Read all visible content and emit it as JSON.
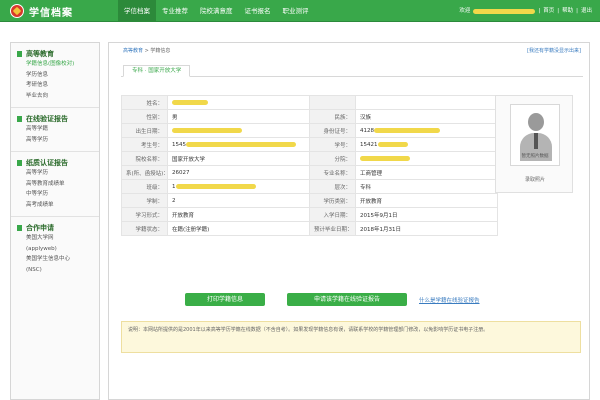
{
  "brand": {
    "title": "学信档案"
  },
  "nav": {
    "items": [
      {
        "label": "学信档案",
        "active": true
      },
      {
        "label": "专业推荐",
        "active": false
      },
      {
        "label": "院校满意度",
        "active": false
      },
      {
        "label": "证书报名",
        "active": false
      },
      {
        "label": "职业测评",
        "active": false
      }
    ]
  },
  "user": {
    "greeting": "欢迎",
    "home": "首页",
    "help": "帮助",
    "logout": "退出",
    "sep": "|"
  },
  "sidebar": {
    "groups": [
      {
        "title": "高等教育",
        "items": [
          {
            "label": "学籍信息(图像校对)",
            "active": true
          },
          {
            "label": "学历信息",
            "active": false
          },
          {
            "label": "考研信息",
            "active": false
          },
          {
            "label": "毕业去向",
            "active": false
          }
        ]
      },
      {
        "title": "在线验证报告",
        "items": [
          {
            "label": "高等学籍",
            "active": false
          },
          {
            "label": "高等学历",
            "active": false
          }
        ]
      },
      {
        "title": "纸质认证报告",
        "items": [
          {
            "label": "高等学历",
            "active": false
          },
          {
            "label": "高等教育成绩单",
            "active": false
          },
          {
            "label": "中等学历",
            "active": false
          },
          {
            "label": "高考成绩单",
            "active": false
          }
        ]
      },
      {
        "title": "合作申请",
        "items": [
          {
            "label": "美国大学网",
            "active": false
          },
          {
            "label": "(applyweb)",
            "active": false
          },
          {
            "label": "美国学生信息中心",
            "active": false
          },
          {
            "label": "(NSC)",
            "active": false
          }
        ]
      }
    ]
  },
  "breadcrumb": {
    "root": "高等教育",
    "sep": ">",
    "current": "学籍信息"
  },
  "help_link": "[我还有学籍没显示出来]",
  "tab": {
    "label": "专科 · 国家开放大学"
  },
  "record": {
    "rows": [
      [
        {
          "label": "姓名：",
          "value": "",
          "redacted": true,
          "width": 36
        },
        {
          "label": "",
          "value": ""
        }
      ],
      [
        {
          "label": "性别：",
          "value": "男"
        },
        {
          "label": "民族：",
          "value": "汉族"
        }
      ],
      [
        {
          "label": "出生日期：",
          "value": "",
          "redacted": true,
          "width": 70
        },
        {
          "label": "身份证号：",
          "value": "4128",
          "redacted": true,
          "width": 66
        }
      ],
      [
        {
          "label": "考生号：",
          "value": "1545",
          "redacted": true,
          "width": 110
        },
        {
          "label": "学号：",
          "value": "15421",
          "redacted": true,
          "width": 30
        }
      ],
      [
        {
          "label": "院校名称：",
          "value": "国家开放大学"
        },
        {
          "label": "分院：",
          "value": "",
          "redacted": true,
          "width": 50
        }
      ],
      [
        {
          "label": "系(所、函授站)：",
          "value": "26027"
        },
        {
          "label": "专业名称：",
          "value": "工商管理"
        }
      ],
      [
        {
          "label": "班级：",
          "value": "1",
          "redacted": true,
          "width": 80
        },
        {
          "label": "层次：",
          "value": "专科"
        }
      ],
      [
        {
          "label": "学制：",
          "value": "2"
        },
        {
          "label": "学历类别：",
          "value": "开放教育"
        }
      ],
      [
        {
          "label": "学习形式：",
          "value": "开放教育"
        },
        {
          "label": "入学日期：",
          "value": "2015年9月1日"
        }
      ],
      [
        {
          "label": "学籍状态：",
          "value": "在籍(注册学籍)"
        },
        {
          "label": "预计毕业日期：",
          "value": "2018年1月31日"
        }
      ]
    ]
  },
  "photo": {
    "caption": "暂无照片数据",
    "label": "录取照片"
  },
  "actions": {
    "print": "打印学籍信息",
    "apply": "申请该学籍在线验证报告",
    "report_link": "什么是学籍在线验证报告"
  },
  "note": {
    "text": "说明：本网站所提供的是2001年以来高等学历学籍在线数据（不含自考）。如果发现学籍信息有误，请联系学校的学籍管理部门修改，以免影响学历证书电子注册。"
  }
}
